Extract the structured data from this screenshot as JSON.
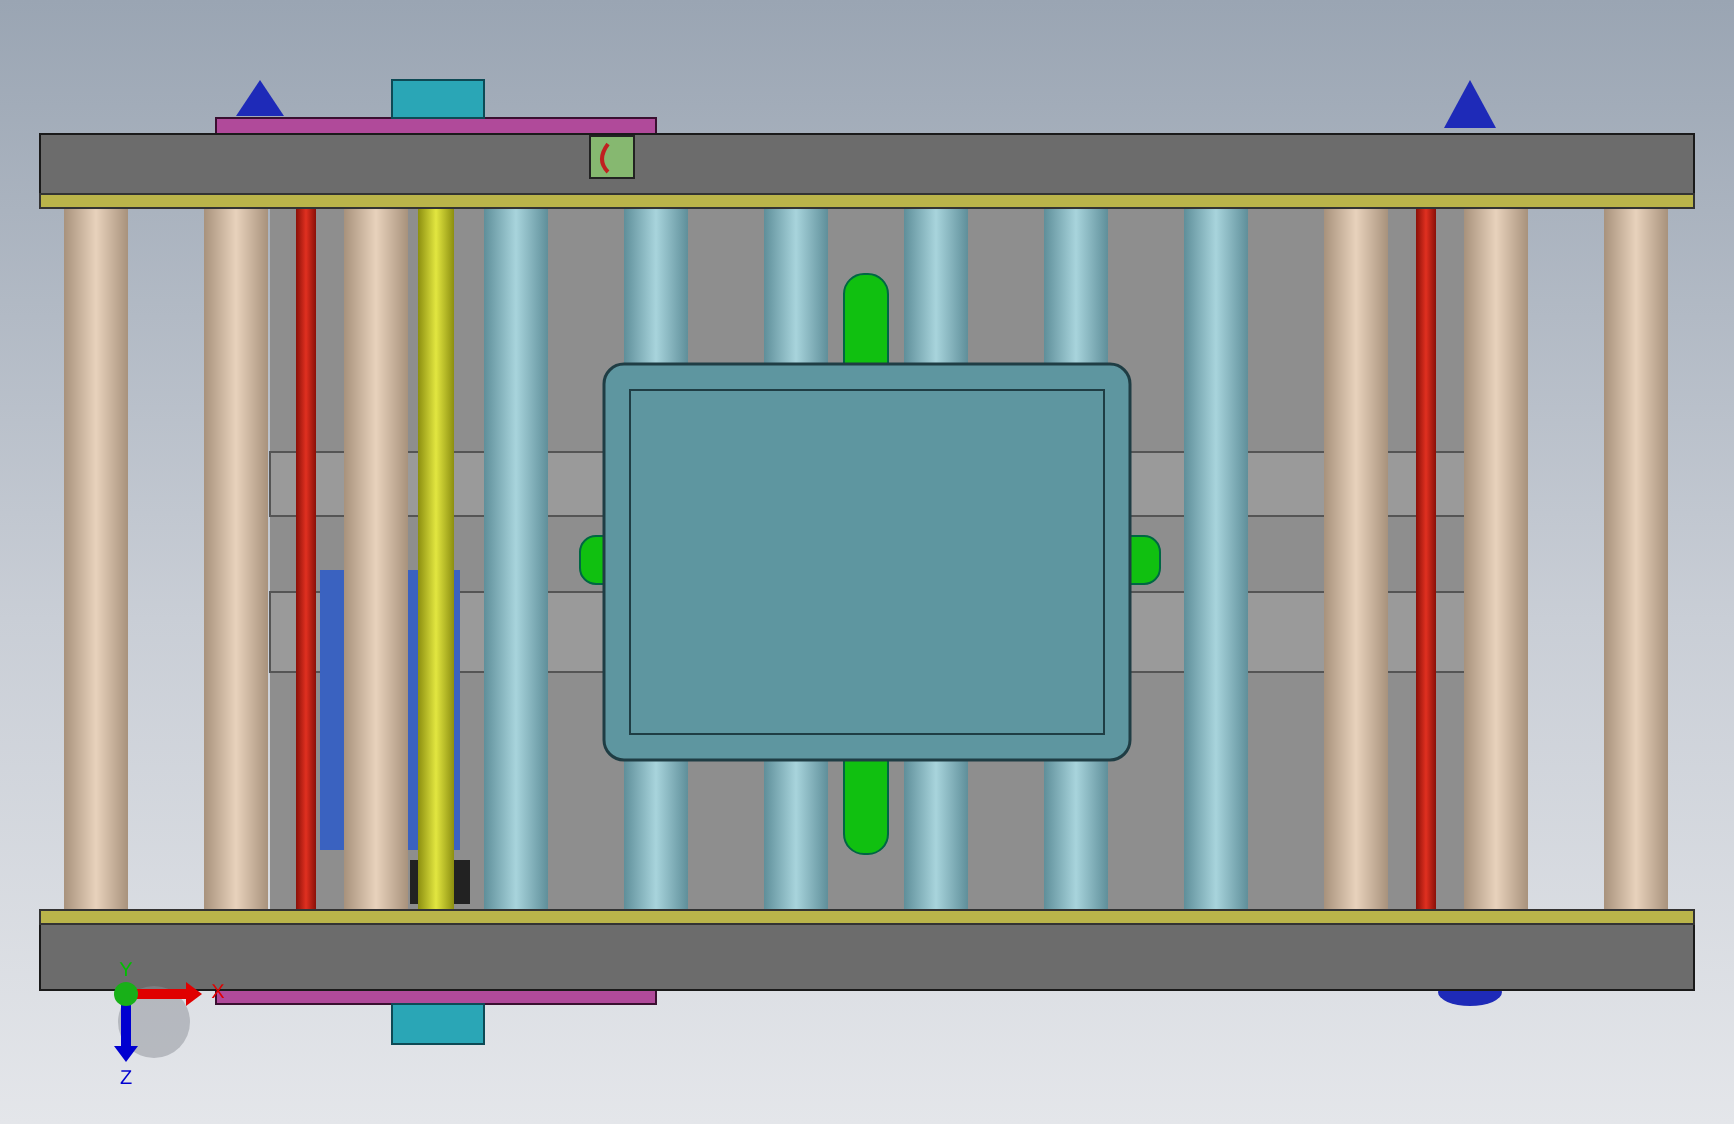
{
  "viewport": {
    "triad": {
      "axes": [
        {
          "label": "Y",
          "color": "#00c000"
        },
        {
          "label": "X",
          "color": "#e00000"
        },
        {
          "label": "Z",
          "color": "#0000d0"
        }
      ]
    }
  }
}
